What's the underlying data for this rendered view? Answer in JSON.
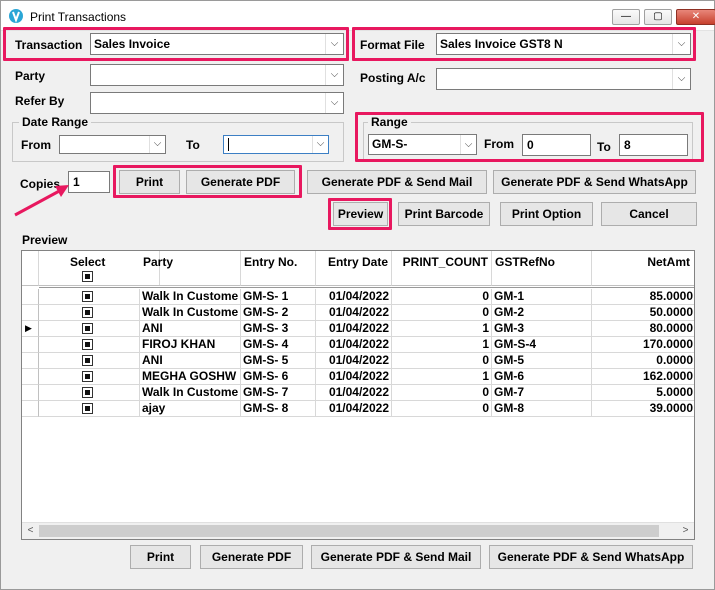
{
  "window": {
    "title": "Print Transactions",
    "min": "—",
    "max": "▢",
    "close": "✕"
  },
  "form": {
    "transaction_label": "Transaction",
    "transaction_value": "Sales Invoice",
    "format_file_label": "Format File",
    "format_file_value": "Sales Invoice GST8 N",
    "party_label": "Party",
    "party_value": "",
    "posting_label": "Posting A/c",
    "posting_value": "",
    "refer_by_label": "Refer By",
    "refer_by_value": "",
    "date_range_title": "Date Range",
    "from_label": "From",
    "to_label": "To",
    "range_title": "Range",
    "range_series": "GM-S-",
    "range_from_label": "From",
    "range_from_value": "0",
    "range_to_label": "To",
    "range_to_value": "8",
    "copies_label": "Copies",
    "copies_value": "1"
  },
  "buttons": {
    "print": "Print",
    "generate_pdf": "Generate PDF",
    "generate_pdf_mail": "Generate PDF & Send Mail",
    "generate_pdf_whatsapp": "Generate PDF & Send WhatsApp",
    "preview": "Preview",
    "print_barcode": "Print Barcode",
    "print_option": "Print Option",
    "cancel": "Cancel"
  },
  "preview": {
    "title": "Preview",
    "columns": [
      "Select",
      "Party",
      "Entry No.",
      "Entry Date",
      "PRINT_COUNT",
      "GSTRefNo",
      "NetAmt"
    ],
    "rows": [
      {
        "party": "Walk In Custome",
        "entry_no": "GM-S- 1",
        "entry_date": "01/04/2022",
        "print_count": "0",
        "gst_ref": "GM-1",
        "net_amt": "85.0000"
      },
      {
        "party": "Walk In Custome",
        "entry_no": "GM-S- 2",
        "entry_date": "01/04/2022",
        "print_count": "0",
        "gst_ref": "GM-2",
        "net_amt": "50.0000"
      },
      {
        "party": "ANI",
        "entry_no": "GM-S- 3",
        "entry_date": "01/04/2022",
        "print_count": "1",
        "gst_ref": "GM-3",
        "net_amt": "80.0000"
      },
      {
        "party": "FIROJ KHAN",
        "entry_no": "GM-S- 4",
        "entry_date": "01/04/2022",
        "print_count": "1",
        "gst_ref": "GM-S-4",
        "net_amt": "170.0000"
      },
      {
        "party": "ANI",
        "entry_no": "GM-S- 5",
        "entry_date": "01/04/2022",
        "print_count": "0",
        "gst_ref": "GM-5",
        "net_amt": "0.0000"
      },
      {
        "party": "MEGHA GOSHW",
        "entry_no": "GM-S- 6",
        "entry_date": "01/04/2022",
        "print_count": "1",
        "gst_ref": "GM-6",
        "net_amt": "162.0000"
      },
      {
        "party": "Walk In Custome",
        "entry_no": "GM-S- 7",
        "entry_date": "01/04/2022",
        "print_count": "0",
        "gst_ref": "GM-7",
        "net_amt": "5.0000"
      },
      {
        "party": "ajay",
        "entry_no": "GM-S- 8",
        "entry_date": "01/04/2022",
        "print_count": "0",
        "gst_ref": "GM-8",
        "net_amt": "39.0000"
      }
    ]
  },
  "colors": {
    "highlight": "#e8185f"
  }
}
